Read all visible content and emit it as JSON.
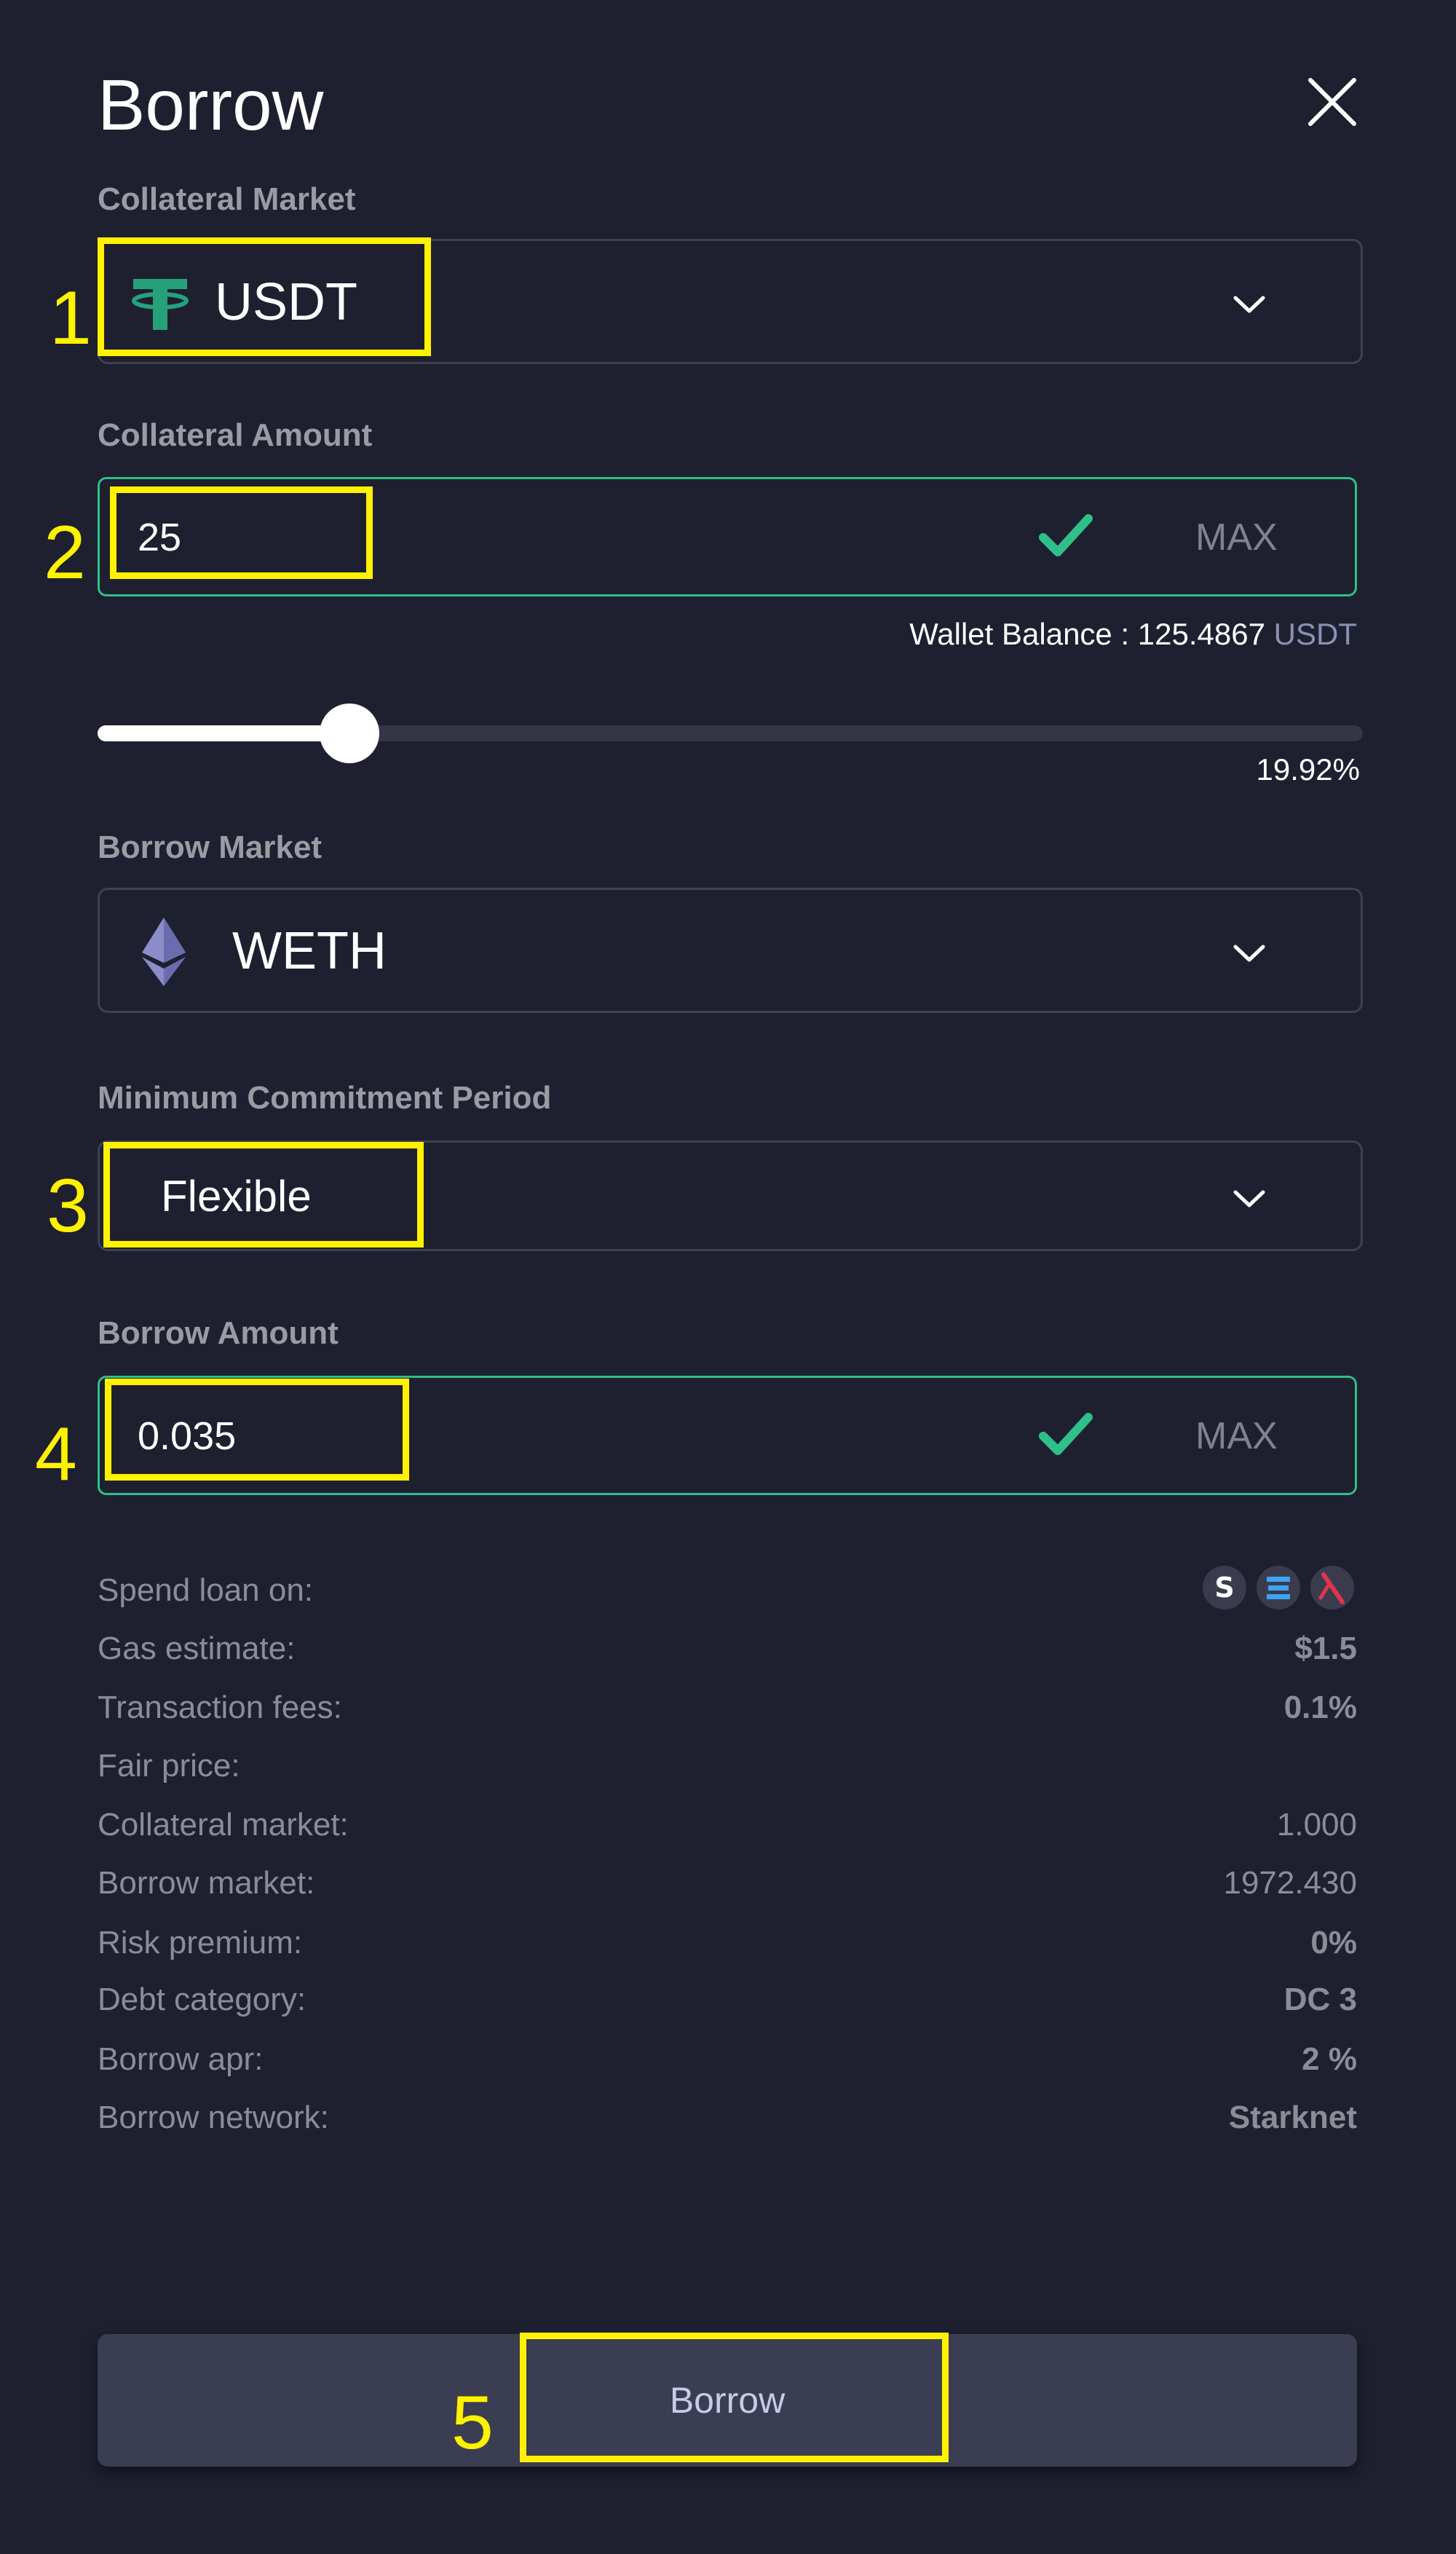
{
  "dialog": {
    "title": "Borrow"
  },
  "collateral_market": {
    "label": "Collateral Market",
    "selected": "USDT",
    "icon": "tether-icon",
    "icon_color": "#26a17b"
  },
  "collateral_amount": {
    "label": "Collateral Amount",
    "value": "25",
    "max_label": "MAX",
    "wallet_balance_label": "Wallet Balance :",
    "wallet_balance_value": "125.4867",
    "wallet_balance_unit": "USDT",
    "slider_percent": 19.92,
    "slider_text": "19.92%"
  },
  "borrow_market": {
    "label": "Borrow Market",
    "selected": "WETH",
    "icon": "ethereum-icon"
  },
  "commitment": {
    "label": "Minimum Commitment Period",
    "selected": "Flexible"
  },
  "borrow_amount": {
    "label": "Borrow Amount",
    "value": "0.035",
    "max_label": "MAX"
  },
  "details": {
    "spend_loan_on": "Spend loan on:",
    "gas_estimate_label": "Gas estimate:",
    "gas_estimate_value": "$1.5",
    "transaction_fees_label": "Transaction fees:",
    "transaction_fees_value": "0.1%",
    "fair_price_label": "Fair price:",
    "collateral_market_label": "Collateral market:",
    "collateral_market_value": "1.000",
    "borrow_market_label": "Borrow market:",
    "borrow_market_value": "1972.430",
    "risk_premium_label": "Risk premium:",
    "risk_premium_value": "0%",
    "debt_category_label": "Debt category:",
    "debt_category_value": "DC 3",
    "borrow_apr_label": "Borrow apr:",
    "borrow_apr_value": "2 %",
    "borrow_network_label": "Borrow network:",
    "borrow_network_value": "Starknet"
  },
  "spend_icons": [
    "s-protocol-icon",
    "zklend-icon",
    "jediswap-icon"
  ],
  "submit": {
    "label": "Borrow"
  },
  "annotations": {
    "step1": "1",
    "step2": "2",
    "step3": "3",
    "step4": "4",
    "step5": "5"
  },
  "colors": {
    "background": "#1e2030",
    "valid_border": "#2fbf88",
    "highlight": "#fff200",
    "button_bg": "#3b3d52"
  }
}
